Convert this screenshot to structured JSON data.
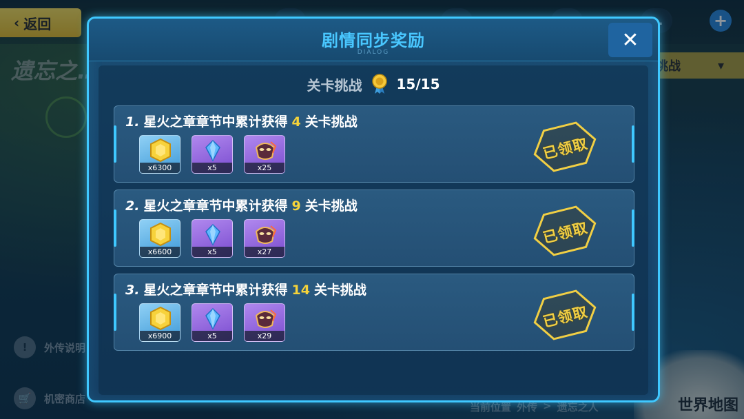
{
  "background": {
    "back_label": "返回",
    "top_stats": [
      "…",
      "…",
      "…",
      "…"
    ],
    "page_title": "遗忘之…",
    "dropdown_label": "挑战",
    "side_items": [
      "外传说明",
      "机密商店"
    ],
    "breadcrumb": [
      "当前位置",
      "外传",
      ">",
      "遗忘之人"
    ],
    "worldmap_label": "世界地图"
  },
  "dialog": {
    "title": "剧情同步奖励",
    "subtitle": "DIALOG",
    "close_icon": "close-icon",
    "progress_label": "关卡挑战",
    "progress_value": "15/15",
    "medal_icon": "medal-icon"
  },
  "rewards": [
    {
      "number": "1.",
      "text_before": "星火之章章节中累计获得",
      "count": "4",
      "text_after": "关卡挑战",
      "items": [
        {
          "icon": "gold-coin-icon",
          "qty": "x6300"
        },
        {
          "icon": "blue-crystal-icon",
          "qty": "x5"
        },
        {
          "icon": "mask-icon",
          "qty": "x25"
        }
      ],
      "stamp": "已领取"
    },
    {
      "number": "2.",
      "text_before": "星火之章章节中累计获得",
      "count": "9",
      "text_after": "关卡挑战",
      "items": [
        {
          "icon": "gold-coin-icon",
          "qty": "x6600"
        },
        {
          "icon": "blue-crystal-icon",
          "qty": "x5"
        },
        {
          "icon": "mask-icon",
          "qty": "x27"
        }
      ],
      "stamp": "已领取"
    },
    {
      "number": "3.",
      "text_before": "星火之章章节中累计获得",
      "count": "14",
      "text_after": "关卡挑战",
      "items": [
        {
          "icon": "gold-coin-icon",
          "qty": "x6900"
        },
        {
          "icon": "blue-crystal-icon",
          "qty": "x5"
        },
        {
          "icon": "mask-icon",
          "qty": "x29"
        }
      ],
      "stamp": "已领取"
    }
  ],
  "colors": {
    "accent": "#3fc8ff",
    "count_highlight": "#f5d33a",
    "stamp": "#f1cf44"
  }
}
